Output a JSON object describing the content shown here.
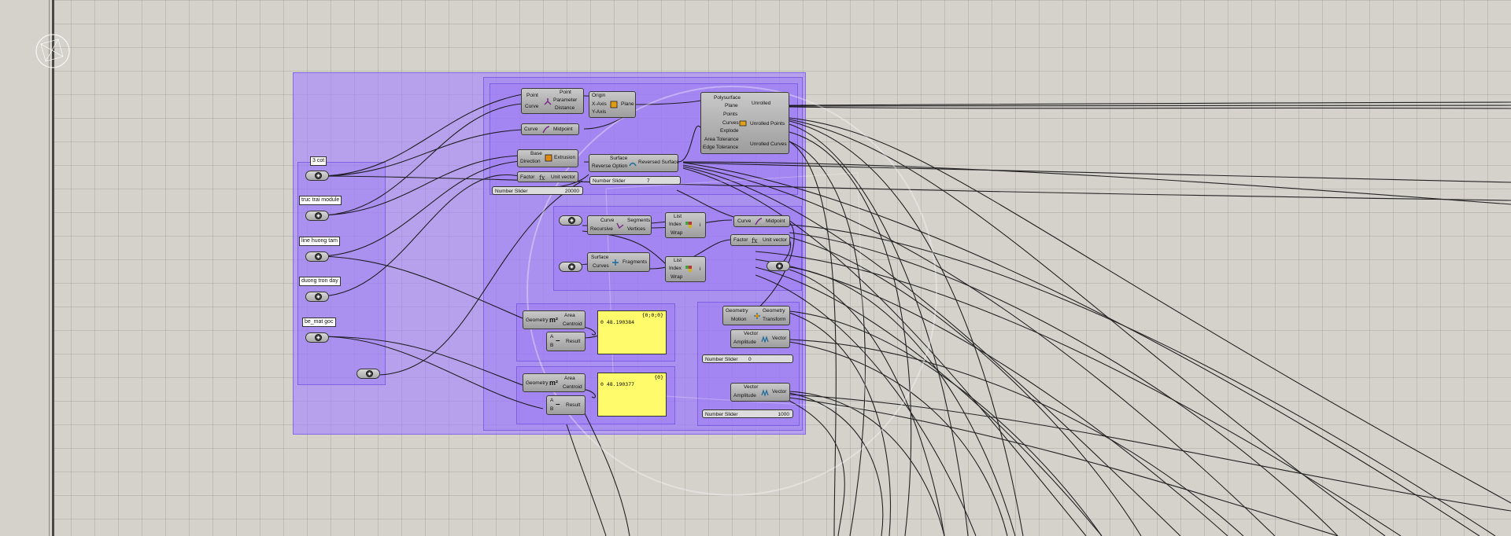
{
  "canvas": {
    "background": "#d5d2cc",
    "group_color": "#a582ff",
    "panel_color": "#fffb6b",
    "logo": "grasshopper-logo-icon"
  },
  "labels": {
    "tag_3cot": "3 cot",
    "tag_truc_trai": "truc trai module",
    "tag_line_huong": "line huong tam",
    "tag_duong_tron": "duong tron day",
    "tag_be_mat": "be_mat goc"
  },
  "nodes": {
    "eval": {
      "in1": "Point",
      "in2": "Curve",
      "out1": "Point",
      "out2": "Parameter",
      "out3": "Distance"
    },
    "plane": {
      "in1": "Origin",
      "in2": "X-Axis",
      "in3": "Y-Axis",
      "out1": "Plane"
    },
    "midpoint": {
      "in1": "Curve",
      "out1": "Midpoint"
    },
    "extrude": {
      "in1": "Base",
      "in2": "Direction",
      "out1": "Extrusion"
    },
    "unitvec": {
      "in1": "Factor",
      "out1": "Unit vector"
    },
    "reverse": {
      "in1": "Surface",
      "in2": "Reverse Option",
      "out1": "Reversed Surface"
    },
    "unroll": {
      "inputs": [
        "Polysurface",
        "Plane",
        "Points",
        "Curves",
        "Explode",
        "Area Tolerance",
        "Edge Tolerance"
      ],
      "out1": "Unrolled",
      "out2": "Unrolled Points",
      "out3": "Unrolled Curves"
    },
    "explode": {
      "in1": "Curve",
      "in2": "Recursive",
      "out1": "Segments",
      "out2": "Vertices"
    },
    "list1": {
      "in1": "List",
      "in2": "Index",
      "in3": "Wrap",
      "out1": "i"
    },
    "frag": {
      "in1": "Surface",
      "in2": "Curves",
      "out1": "Fragments"
    },
    "list2": {
      "in1": "List",
      "in2": "Index",
      "in3": "Wrap",
      "out1": "i"
    },
    "midpoint2": {
      "in1": "Curve",
      "out1": "Midpoint"
    },
    "unitvec2": {
      "in1": "Factor",
      "out1": "Unit vector"
    },
    "area1": {
      "in1": "Geometry",
      "out1": "Area",
      "out2": "Centroid"
    },
    "sub1": {
      "in1": "A",
      "in2": "B",
      "out1": "Result"
    },
    "area2": {
      "in1": "Geometry",
      "out1": "Area",
      "out2": "Centroid"
    },
    "sub2": {
      "in1": "A",
      "in2": "B",
      "out1": "Result"
    },
    "move": {
      "in1": "Geometry",
      "in2": "Motion",
      "out1": "Geometry",
      "out2": "Transform"
    },
    "amp1": {
      "in1": "Vector",
      "in2": "Amplitude",
      "out1": "Vector"
    },
    "amp2": {
      "in1": "Vector",
      "in2": "Amplitude",
      "out1": "Vector"
    }
  },
  "sliders": {
    "s20000": {
      "label": "Number Slider",
      "value": "20000"
    },
    "s7": {
      "label": "Number Slider",
      "value": "7"
    },
    "s0": {
      "label": "Number Slider",
      "value": "0"
    },
    "s1000": {
      "label": "Number Slider",
      "value": "1000"
    }
  },
  "panels": {
    "p1": {
      "header": "{0;0;0}",
      "value": "0 48.190384"
    },
    "p2": {
      "header": "{0}",
      "value": "0 48.190377"
    }
  }
}
